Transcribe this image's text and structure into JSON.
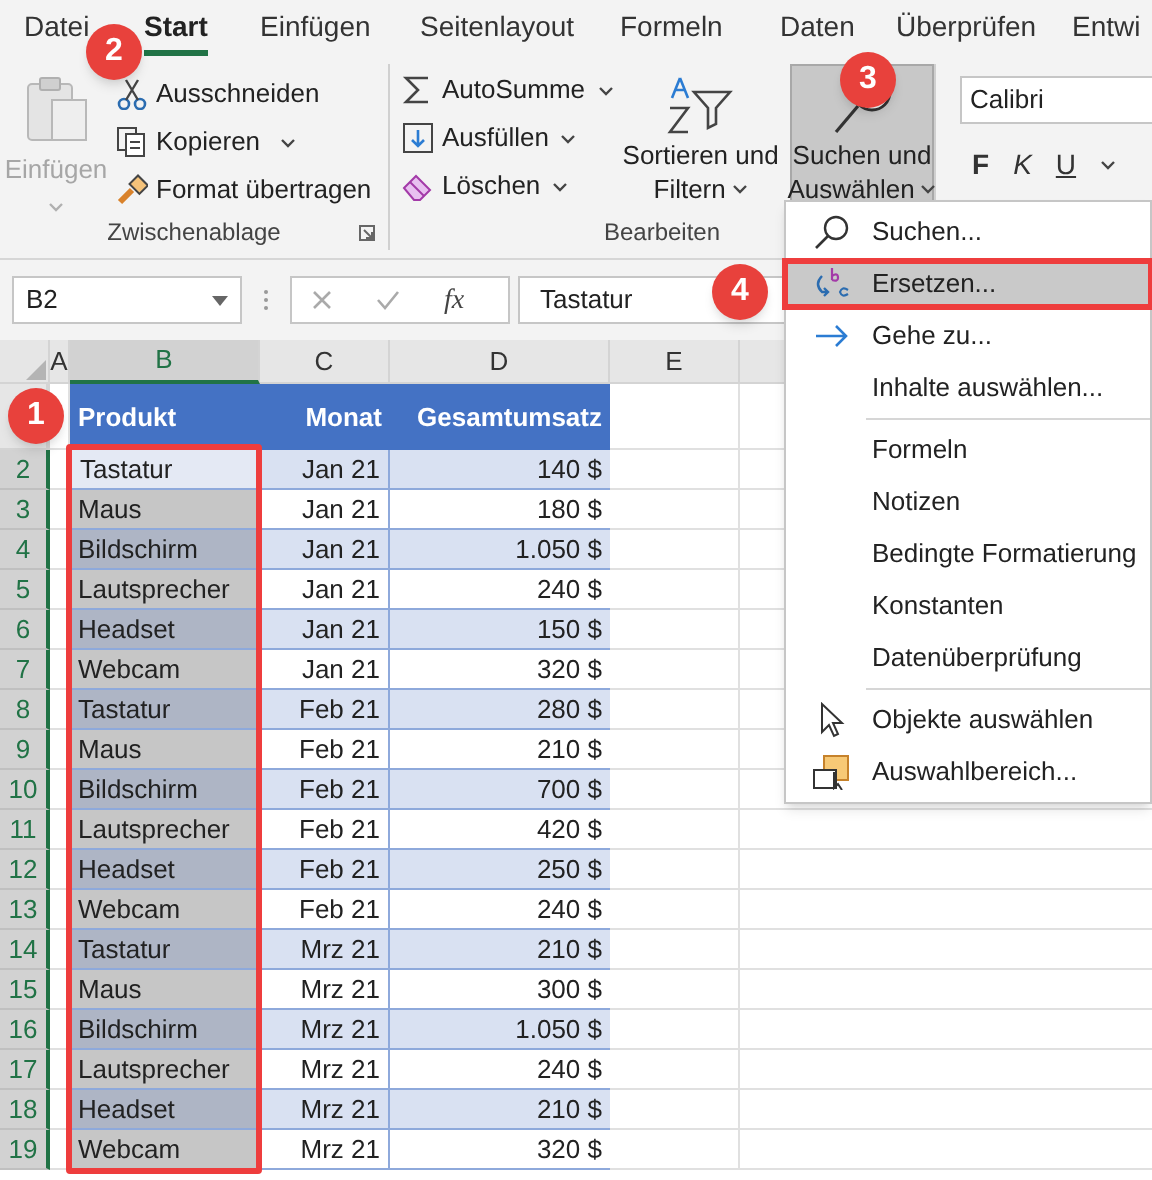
{
  "ribbon_tabs": [
    {
      "label": "Datei",
      "selected": false
    },
    {
      "label": "Start",
      "selected": true
    },
    {
      "label": "Einfügen",
      "selected": false
    },
    {
      "label": "Seitenlayout",
      "selected": false
    },
    {
      "label": "Formeln",
      "selected": false
    },
    {
      "label": "Daten",
      "selected": false
    },
    {
      "label": "Überprüfen",
      "selected": false
    },
    {
      "label": "Entwi",
      "selected": false
    }
  ],
  "clipboard_group": {
    "title": "Zwischenablage",
    "paste": {
      "label": "Einfügen",
      "disabled": true
    },
    "items": [
      {
        "kind": "cut",
        "label": "Ausschneiden",
        "dropdown": false
      },
      {
        "kind": "copy",
        "label": "Kopieren",
        "dropdown": true
      },
      {
        "kind": "format",
        "label": "Format übertragen",
        "dropdown": false
      }
    ]
  },
  "editing_group": {
    "title": "Bearbeiten",
    "items": [
      {
        "kind": "sum",
        "label": "AutoSumme",
        "dropdown": true
      },
      {
        "kind": "fill",
        "label": "Ausfüllen",
        "dropdown": true
      },
      {
        "kind": "clear",
        "label": "Löschen",
        "dropdown": true
      }
    ],
    "sort": {
      "label_lines": [
        "Sortieren und",
        "Filtern"
      ],
      "pressed": false
    },
    "find": {
      "label_lines": [
        "Suchen und",
        "Auswählen"
      ],
      "pressed": true
    }
  },
  "font_group": {
    "font_name": "Calibri",
    "buttons": [
      {
        "kind": "bold",
        "label": "F"
      },
      {
        "kind": "italic",
        "label": "K"
      },
      {
        "kind": "underline",
        "label": "U"
      }
    ]
  },
  "formula_bar": {
    "name_box": "B2",
    "function_label": "fx",
    "formula": "Tastatur"
  },
  "columns": [
    {
      "label": "A",
      "selected": false
    },
    {
      "label": "B",
      "selected": true
    },
    {
      "label": "C",
      "selected": false
    },
    {
      "label": "D",
      "selected": false
    },
    {
      "label": "E",
      "selected": false
    }
  ],
  "header_row": {
    "cells": [
      "Produkt",
      "Monat",
      "Gesamtumsatz"
    ]
  },
  "rows": [
    {
      "number": "2",
      "product": "Tastatur",
      "month": "Jan 21",
      "total": "140 $",
      "active": true
    },
    {
      "number": "3",
      "product": "Maus",
      "month": "Jan 21",
      "total": "180 $",
      "active": false
    },
    {
      "number": "4",
      "product": "Bildschirm",
      "month": "Jan 21",
      "total": "1.050 $",
      "active": false
    },
    {
      "number": "5",
      "product": "Lautsprecher",
      "month": "Jan 21",
      "total": "240 $",
      "active": false
    },
    {
      "number": "6",
      "product": "Headset",
      "month": "Jan 21",
      "total": "150 $",
      "active": false
    },
    {
      "number": "7",
      "product": "Webcam",
      "month": "Jan 21",
      "total": "320 $",
      "active": false
    },
    {
      "number": "8",
      "product": "Tastatur",
      "month": "Feb 21",
      "total": "280 $",
      "active": false
    },
    {
      "number": "9",
      "product": "Maus",
      "month": "Feb 21",
      "total": "210 $",
      "active": false
    },
    {
      "number": "10",
      "product": "Bildschirm",
      "month": "Feb 21",
      "total": "700 $",
      "active": false
    },
    {
      "number": "11",
      "product": "Lautsprecher",
      "month": "Feb 21",
      "total": "420 $",
      "active": false
    },
    {
      "number": "12",
      "product": "Headset",
      "month": "Feb 21",
      "total": "250 $",
      "active": false
    },
    {
      "number": "13",
      "product": "Webcam",
      "month": "Feb 21",
      "total": "240 $",
      "active": false
    },
    {
      "number": "14",
      "product": "Tastatur",
      "month": "Mrz 21",
      "total": "210 $",
      "active": false
    },
    {
      "number": "15",
      "product": "Maus",
      "month": "Mrz 21",
      "total": "300 $",
      "active": false
    },
    {
      "number": "16",
      "product": "Bildschirm",
      "month": "Mrz 21",
      "total": "1.050 $",
      "active": false
    },
    {
      "number": "17",
      "product": "Lautsprecher",
      "month": "Mrz 21",
      "total": "240 $",
      "active": false
    },
    {
      "number": "18",
      "product": "Headset",
      "month": "Mrz 21",
      "total": "210 $",
      "active": false
    },
    {
      "number": "19",
      "product": "Webcam",
      "month": "Mrz 21",
      "total": "320 $",
      "active": false
    }
  ],
  "find_menu": [
    {
      "kind": "search",
      "label": "Suchen...",
      "highlighted": false,
      "divider_before": false
    },
    {
      "kind": "replace",
      "label": "Ersetzen...",
      "highlighted": true,
      "divider_before": false
    },
    {
      "kind": "goto",
      "label": "Gehe zu...",
      "highlighted": false,
      "divider_before": false
    },
    {
      "kind": "none",
      "label": "Inhalte auswählen...",
      "highlighted": false,
      "divider_before": false
    },
    {
      "kind": "none",
      "label": "Formeln",
      "highlighted": false,
      "divider_before": true
    },
    {
      "kind": "none",
      "label": "Notizen",
      "highlighted": false,
      "divider_before": false
    },
    {
      "kind": "none",
      "label": "Bedingte Formatierung",
      "highlighted": false,
      "divider_before": false
    },
    {
      "kind": "none",
      "label": "Konstanten",
      "highlighted": false,
      "divider_before": false
    },
    {
      "kind": "none",
      "label": "Datenüberprüfung",
      "highlighted": false,
      "divider_before": false
    },
    {
      "kind": "pointer",
      "label": "Objekte auswählen",
      "highlighted": false,
      "divider_before": true
    },
    {
      "kind": "pane",
      "label": "Auswahlbereich...",
      "highlighted": false,
      "divider_before": false
    }
  ],
  "callouts": [
    "1",
    "2",
    "3",
    "4"
  ]
}
